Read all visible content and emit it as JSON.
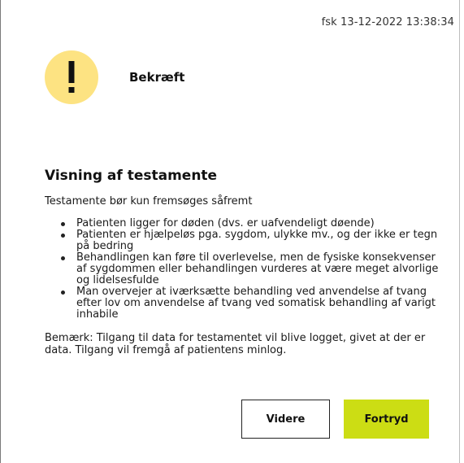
{
  "status_bar": {
    "timestamp": "fsk 13-12-2022 13:38:34"
  },
  "dialog": {
    "icon": "exclamation-icon",
    "title": "Bekræft",
    "accent_color": "#fde382",
    "section_title": "Visning af testamente",
    "intro": "Testamente bør kun fremsøges såfremt",
    "bullets": [
      "Patienten ligger for døden (dvs. er uafvendeligt døende)",
      "Patienten er hjælpeløs pga. sygdom, ulykke mv., og der ikke er tegn på bedring",
      "Behandlingen kan føre til overlevelse, men de fysiske konsekvenser af sygdommen eller behandlingen vurderes at være meget alvorlige og lidelsesfulde",
      "Man overvejer at iværksætte behandling ved anvendelse af tvang efter lov om anvendelse af tvang ved somatisk behandling af varigt inhabile"
    ],
    "note": "Bemærk: Tilgang til data for testamentet vil blive logget, givet at der er data. Tilgang vil fremgå af patientens minlog."
  },
  "buttons": {
    "continue_label": "Videre",
    "cancel_label": "Fortryd",
    "cancel_color": "#ccdd14"
  }
}
